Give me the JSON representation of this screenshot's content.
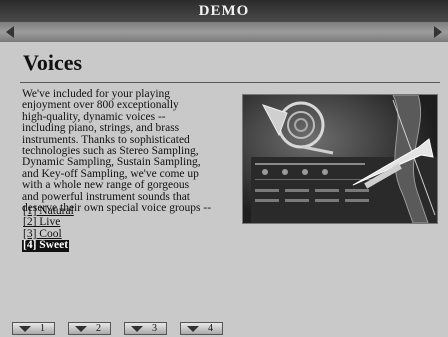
{
  "window": {
    "title": "DEMO"
  },
  "page": {
    "title": "Voices",
    "body": "We've included for your playing\nenjoyment over 800 exceptionally\nhigh-quality, dynamic voices --\nincluding piano, strings, and brass\ninstruments.  Thanks to sophisticated\ntechnologies such as Stereo Sampling,\nDynamic Sampling, Sustain Sampling,\nand Key-off Sampling, we've come up\nwith a whole new range of gorgeous\nand powerful instrument sounds that\ndeserve their own special voice groups --",
    "voice_groups": [
      {
        "label": "[1] Natural",
        "selected": false
      },
      {
        "label": "[2] Live",
        "selected": false
      },
      {
        "label": "[3] Cool",
        "selected": false
      },
      {
        "label": "[4] Sweet",
        "selected": true
      }
    ]
  },
  "footer": {
    "page_buttons": [
      "1",
      "2",
      "3",
      "4"
    ]
  },
  "icons": {
    "scroll_left": "left-arrow-icon",
    "scroll_right": "right-arrow-icon",
    "page_button": "down-triangle-icon"
  }
}
